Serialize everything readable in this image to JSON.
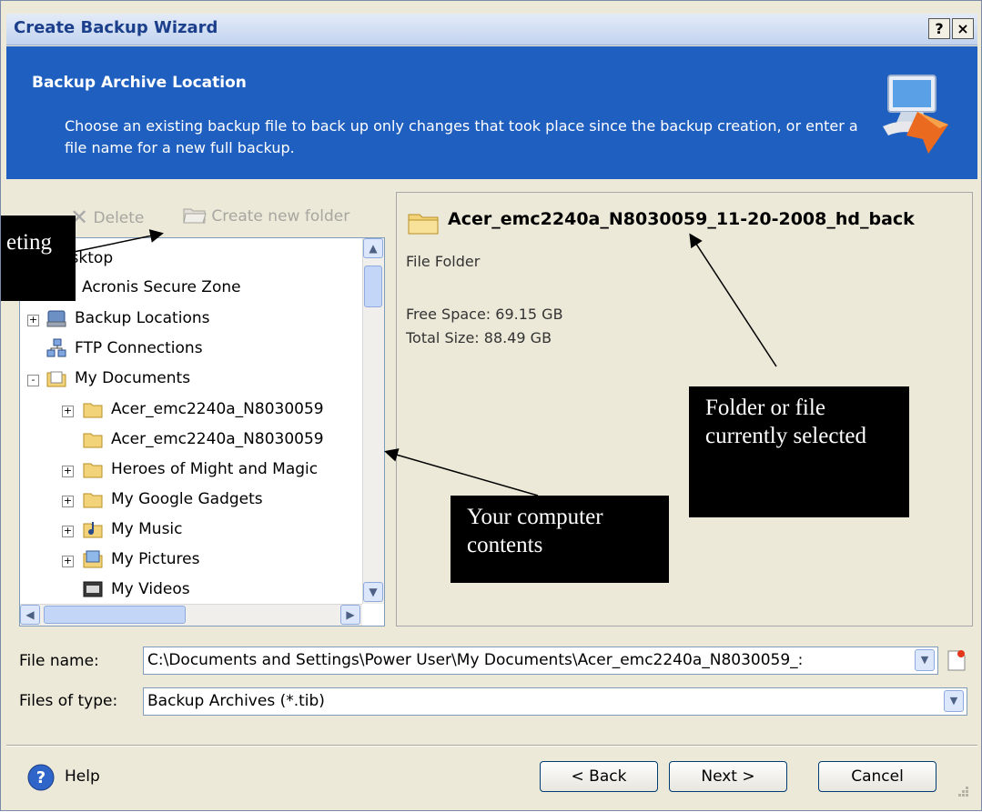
{
  "window": {
    "title": "Create Backup Wizard",
    "help_btn": "?",
    "close_btn": "×"
  },
  "header": {
    "title": "Backup Archive Location",
    "description": "Choose an existing backup file to back up only changes that took place since the backup creation, or enter a file name for a new full backup."
  },
  "toolbar": {
    "delete_label": "Delete",
    "new_folder_label": "Create new folder"
  },
  "tree": {
    "items": [
      {
        "label": "Desktop",
        "expander": ""
      },
      {
        "label": "Acronis Secure Zone",
        "expander": ""
      },
      {
        "label": "Backup Locations",
        "expander": "+"
      },
      {
        "label": "FTP Connections",
        "expander": ""
      },
      {
        "label": "My Documents",
        "expander": "-"
      },
      {
        "label": "Acer_emc2240a_N8030059",
        "expander": "+"
      },
      {
        "label": "Acer_emc2240a_N8030059",
        "expander": ""
      },
      {
        "label": "Heroes of Might and Magic",
        "expander": "+"
      },
      {
        "label": "My Google Gadgets",
        "expander": "+"
      },
      {
        "label": "My Music",
        "expander": "+"
      },
      {
        "label": "My Pictures",
        "expander": "+"
      },
      {
        "label": "My Videos",
        "expander": ""
      }
    ]
  },
  "details": {
    "name": "Acer_emc2240a_N8030059_11-20-2008_hd_back",
    "type": "File Folder",
    "free_space": "Free Space: 69.15 GB",
    "total_size": "Total Size: 88.49 GB"
  },
  "callouts": {
    "deleting": "eting",
    "selected": "Folder or file currently selected",
    "contents": "Your computer contents"
  },
  "fields": {
    "file_name_label": "File name:",
    "file_name_value": "C:\\Documents and Settings\\Power User\\My Documents\\Acer_emc2240a_N8030059_:",
    "file_type_label": "Files of type:",
    "file_type_value": "Backup Archives (*.tib)"
  },
  "footer": {
    "help_label": "Help",
    "back_label": "< Back",
    "next_label": "Next >",
    "cancel_label": "Cancel"
  },
  "colors": {
    "banner": "#1f5fbf",
    "title_text": "#1c3f8c",
    "folder": "#f3d37a"
  }
}
